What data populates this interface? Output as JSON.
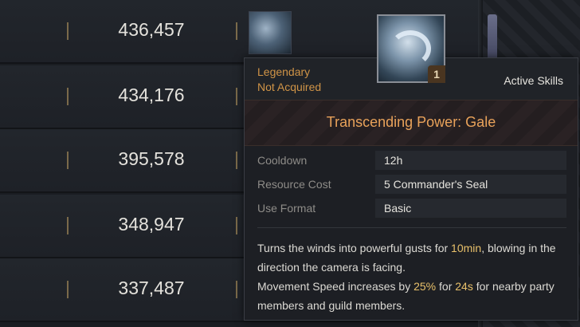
{
  "rows": [
    {
      "score": "436,457"
    },
    {
      "score": "434,176"
    },
    {
      "score": "395,578"
    },
    {
      "score": "348,947"
    },
    {
      "score": "337,487"
    }
  ],
  "tooltip": {
    "rarity": "Legendary",
    "status": "Not Acquired",
    "category": "Active Skills",
    "icon_name": "wind-swirl-icon",
    "icon_count": "1",
    "skill_name": "Transcending Power: Gale",
    "stats": [
      {
        "label": "Cooldown",
        "value": "12h"
      },
      {
        "label": "Resource Cost",
        "value": "5  Commander's Seal"
      },
      {
        "label": "Use Format",
        "value": "Basic"
      }
    ],
    "description": {
      "part1": "Turns the winds into powerful gusts for ",
      "hl1": "10min",
      "part2": ", blowing in the direction the camera is facing.",
      "part3": "Movement Speed increases by ",
      "hl2": "25%",
      "part4": " for ",
      "hl3": "24s",
      "part5": " for nearby party members and guild members."
    }
  },
  "colors": {
    "rarity": "#d09447",
    "skill_name": "#e8a25a",
    "highlight": "#e8c06a"
  }
}
